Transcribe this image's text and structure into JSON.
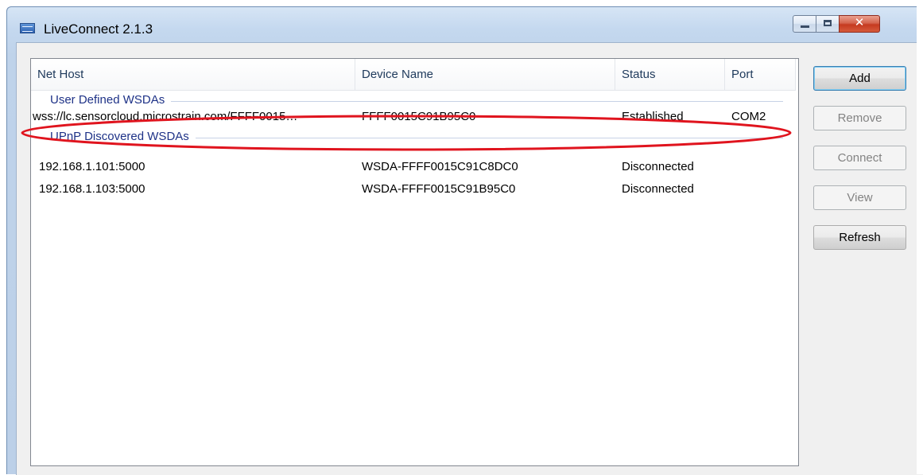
{
  "window": {
    "title": "LiveConnect 2.1.3",
    "close_glyph": "✕"
  },
  "columns": [
    "Net Host",
    "Device Name",
    "Status",
    "Port"
  ],
  "groups": [
    {
      "label": "User Defined WSDAs",
      "rows": [
        {
          "host": "wss://lc.sensorcloud.microstrain.com/FFFF0015…",
          "device": "FFFF0015C91B95C0",
          "status": "Established",
          "port": "COM2"
        }
      ]
    },
    {
      "label": "UPnP Discovered WSDAs",
      "rows": [
        {
          "host": "192.168.1.101:5000",
          "device": "WSDA-FFFF0015C91C8DC0",
          "status": "Disconnected",
          "port": ""
        },
        {
          "host": "192.168.1.103:5000",
          "device": "WSDA-FFFF0015C91B95C0",
          "status": "Disconnected",
          "port": ""
        }
      ]
    }
  ],
  "buttons": {
    "add": "Add",
    "remove": "Remove",
    "connect": "Connect",
    "view": "View",
    "refresh": "Refresh"
  },
  "annotation_color": "#e0141e"
}
